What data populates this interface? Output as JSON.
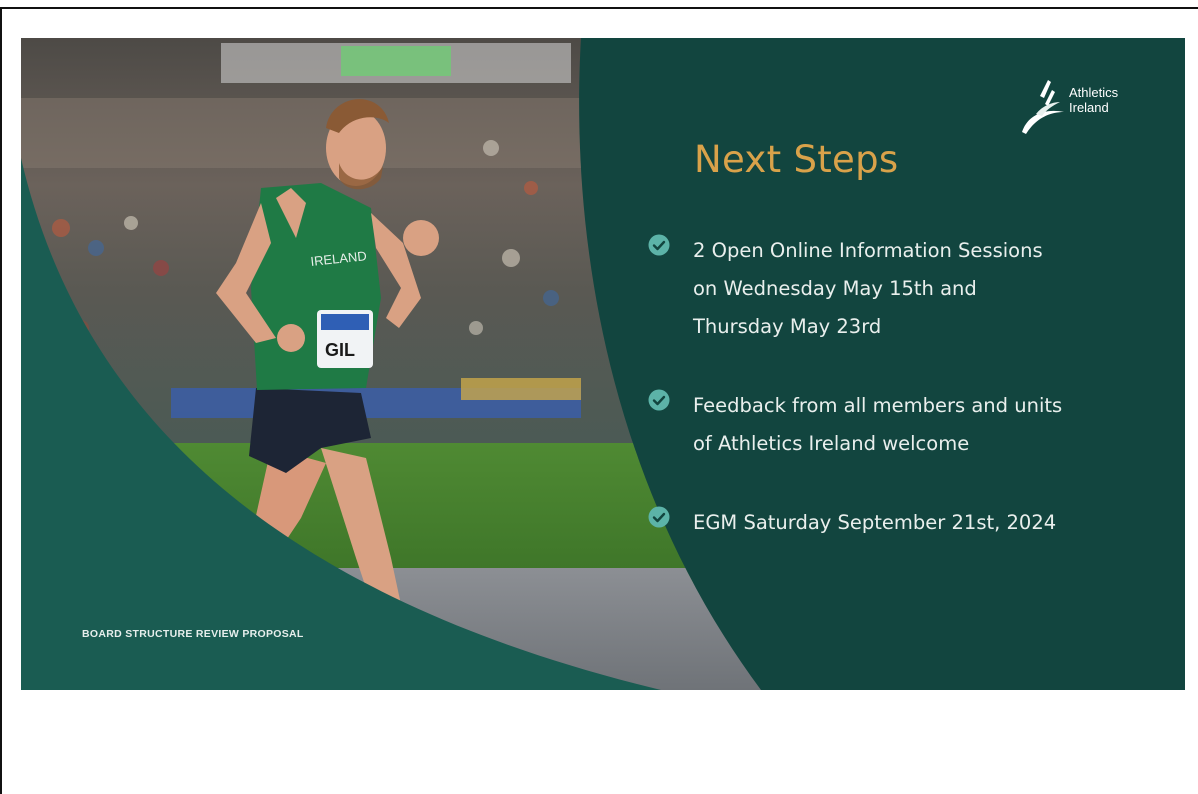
{
  "slide": {
    "title": "Next Steps",
    "footer": "BOARD STRUCTURE REVIEW PROPOSAL",
    "logo": {
      "line1": "Athletics",
      "line2": "Ireland"
    },
    "bullets": [
      {
        "lines": [
          "2 Open Online Information Sessions",
          "on Wednesday May 15th and",
          "Thursday May 23rd"
        ],
        "icon": "check-circle-icon"
      },
      {
        "lines": [
          "Feedback from all members and units",
          "of Athletics Ireland welcome"
        ],
        "icon": "check-circle-icon"
      },
      {
        "lines": [
          "EGM Saturday September 21st, 2024"
        ],
        "icon": "check-circle-icon"
      }
    ],
    "photo": {
      "vest_text": "IRELAND",
      "bib_text": "GIL"
    },
    "colors": {
      "panel": "#12453f",
      "accent_title": "#d9a24a",
      "check": "#5cb3a8",
      "text": "#e9efed"
    }
  }
}
